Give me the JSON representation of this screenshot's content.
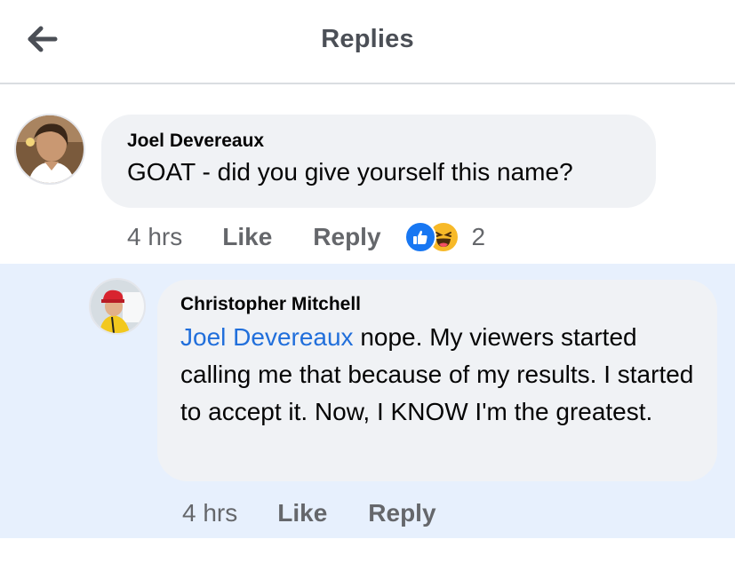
{
  "header": {
    "title": "Replies",
    "back_icon": "arrow-left-icon"
  },
  "comments": [
    {
      "author": "Joel Devereaux",
      "text": "GOAT - did you give yourself this name?",
      "time": "4 hrs",
      "like_label": "Like",
      "reply_label": "Reply",
      "reaction_icons": [
        "like-reaction-icon",
        "haha-reaction-icon"
      ],
      "reaction_count": "2"
    },
    {
      "author": "Christopher Mitchell",
      "mention": "Joel Devereaux",
      "text": " nope. My viewers started calling me that because of my results. I started to accept it. Now, I KNOW I'm the greatest.",
      "time": "4 hrs",
      "like_label": "Like",
      "reply_label": "Reply",
      "highlighted": true
    }
  ],
  "colors": {
    "mention": "#216fdb",
    "highlight_bg": "#e7f0fd",
    "bubble_bg": "#f0f2f5",
    "meta_text": "#65676b",
    "like_blue": "#1877f2",
    "haha_yellow": "#f7b928"
  }
}
